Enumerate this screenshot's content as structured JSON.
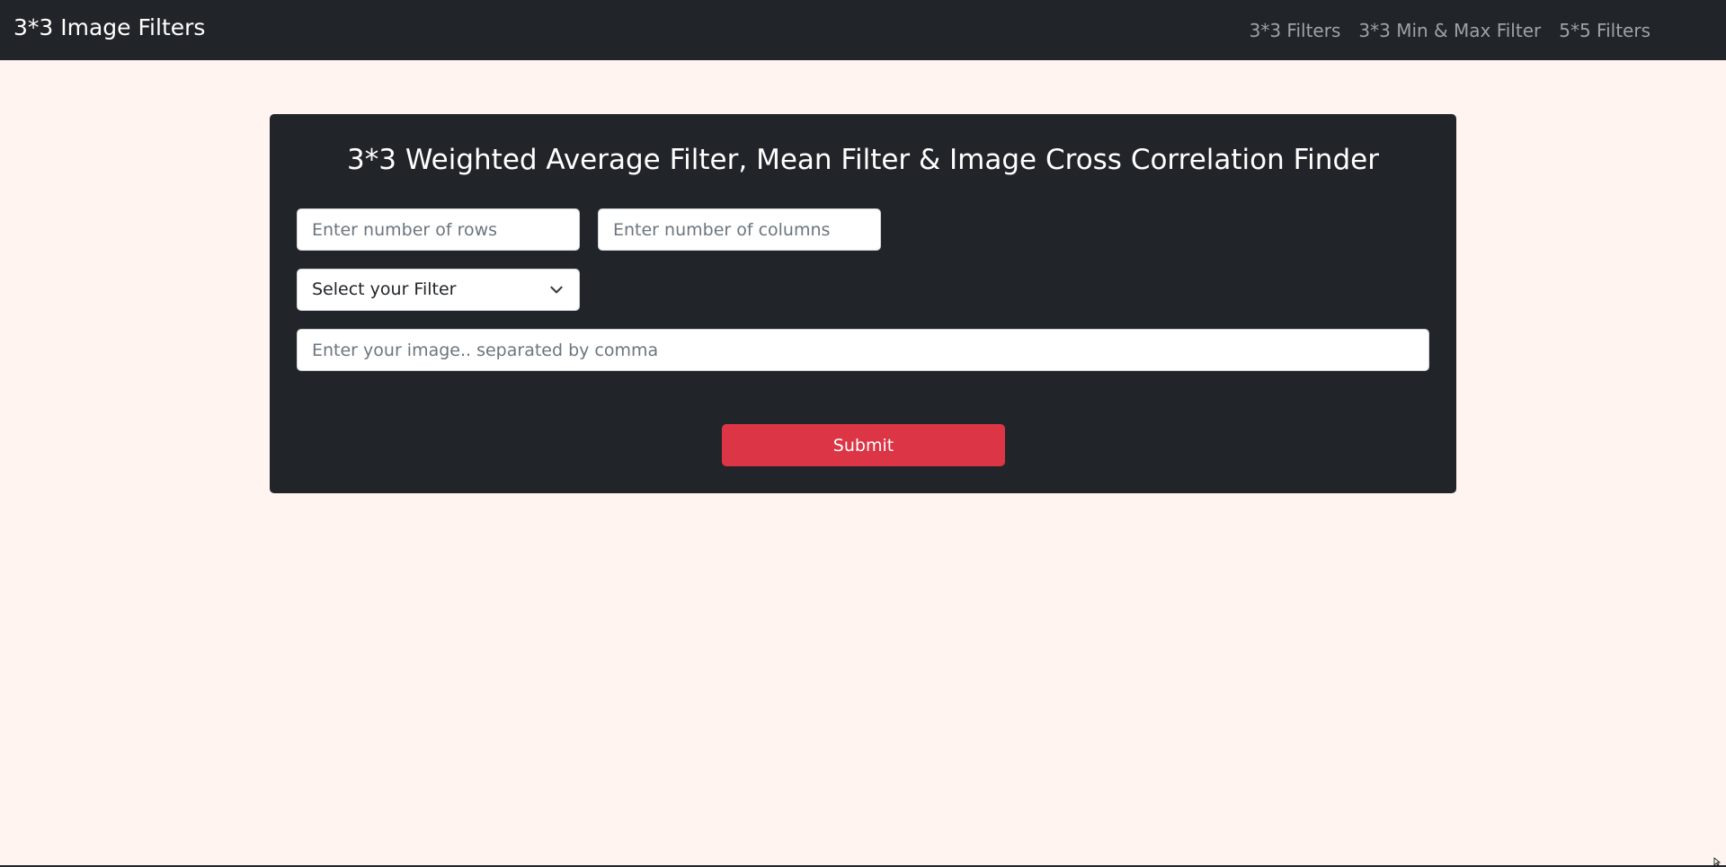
{
  "navbar": {
    "brand": "3*3 Image Filters",
    "links": [
      {
        "label": "3*3 Filters"
      },
      {
        "label": "3*3 Min & Max Filter"
      },
      {
        "label": "5*5 Filters"
      }
    ]
  },
  "form": {
    "title": "3*3 Weighted Average Filter, Mean Filter & Image Cross Correlation Finder",
    "rows": {
      "value": "",
      "placeholder": "Enter number of rows"
    },
    "columns": {
      "value": "",
      "placeholder": "Enter number of columns"
    },
    "filter_select": {
      "selected": "Select your Filter"
    },
    "image": {
      "value": "",
      "placeholder": "Enter your image.. separated by comma"
    },
    "submit_label": "Submit"
  },
  "colors": {
    "page_bg": "#fff4ef",
    "navbar_bg": "#212529",
    "panel_bg": "#212529",
    "submit_bg": "#dc3545",
    "nav_link": "#9ea2a7"
  },
  "icons": {
    "select_arrow": "chevron-down-icon",
    "cursor": "mouse-cursor-icon"
  }
}
